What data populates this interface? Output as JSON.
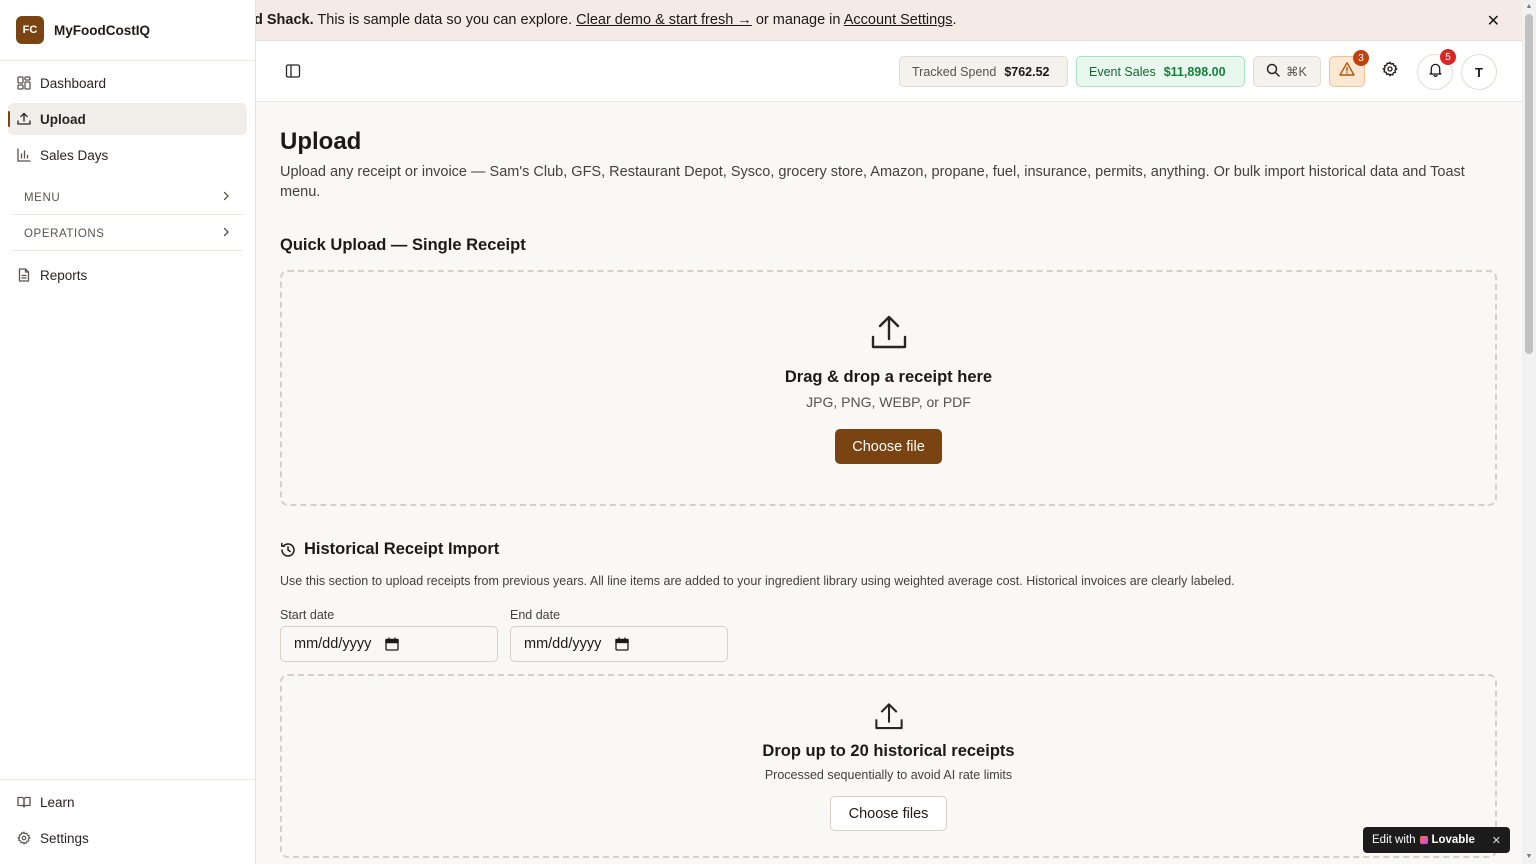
{
  "brand": {
    "logo_text": "FC",
    "name": "MyFoodCostIQ"
  },
  "sidebar": {
    "items": [
      {
        "label": "Dashboard",
        "icon": "dashboard-icon"
      },
      {
        "label": "Upload",
        "icon": "upload-icon",
        "active": true
      },
      {
        "label": "Sales Days",
        "icon": "bar-chart-icon"
      }
    ],
    "sections": [
      {
        "label": "MENU"
      },
      {
        "label": "OPERATIONS"
      }
    ],
    "reports_label": "Reports",
    "bottom": [
      {
        "label": "Learn",
        "icon": "book-icon"
      },
      {
        "label": "Settings",
        "icon": "gear-icon"
      }
    ]
  },
  "banner": {
    "lead": "d Shack.",
    "text": " This is sample data so you can explore. ",
    "link_clear": "Clear demo & start fresh →",
    "mid": " or manage in ",
    "link_settings": "Account Settings",
    "tail": "."
  },
  "header": {
    "tracked_spend_label": "Tracked Spend",
    "tracked_spend_value": "$762.52",
    "event_sales_label": "Event Sales",
    "event_sales_value": "$11,898.00",
    "search_shortcut": "⌘K",
    "alerts_count": "3",
    "notifications_count": "5",
    "avatar_initial": "T"
  },
  "page": {
    "title": "Upload",
    "description": "Upload any receipt or invoice — Sam's Club, GFS, Restaurant Depot, Sysco, grocery store, Amazon, propane, fuel, insurance, permits, anything. Or bulk import historical data and Toast menu."
  },
  "quick_upload": {
    "title": "Quick Upload — Single Receipt",
    "drop_title": "Drag & drop a receipt here",
    "formats": "JPG, PNG, WEBP, or PDF",
    "button": "Choose file"
  },
  "historical": {
    "title": "Historical Receipt Import",
    "description": "Use this section to upload receipts from previous years. All line items are added to your ingredient library using weighted average cost. Historical invoices are clearly labeled.",
    "start_label": "Start date",
    "end_label": "End date",
    "date_placeholder": "mm/dd/yyyy",
    "drop_title": "Drop up to 20 historical receipts",
    "drop_sub": "Processed sequentially to avoid AI rate limits",
    "button": "Choose files"
  },
  "lovable": {
    "prefix": "Edit with",
    "brand": "Lovable",
    "close": "✕"
  },
  "banner_close": "✕"
}
